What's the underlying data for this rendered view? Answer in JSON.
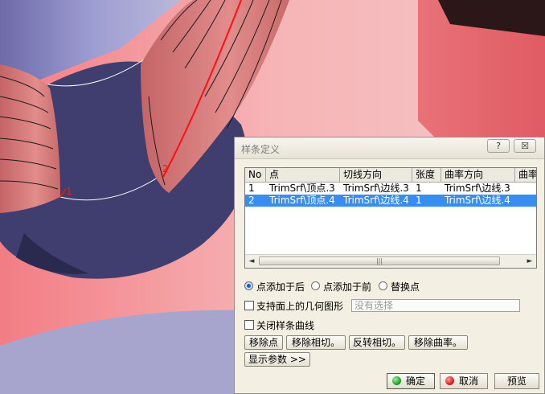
{
  "dialog": {
    "title": "样条定义",
    "help_glyph": "?",
    "close_glyph": "☒"
  },
  "grid": {
    "columns": [
      "No",
      "点",
      "切线方向",
      "张度",
      "曲率方向",
      "曲率"
    ],
    "rows": [
      {
        "no": "1",
        "point": "TrimSrf\\顶点.3",
        "tangent": "TrimSrf\\边线.3",
        "tension": "1",
        "curvature": "TrimSrf\\边线.3",
        "selected": false
      },
      {
        "no": "2",
        "point": "TrimSrf\\顶点.4",
        "tangent": "TrimSrf\\边线.4",
        "tension": "1",
        "curvature": "TrimSrf\\边线.4",
        "selected": true
      }
    ],
    "scroll_left": "◄",
    "scroll_right": "►",
    "scroll_grip": "|||"
  },
  "point_mode": {
    "options": [
      "点添加于后",
      "点添加于前",
      "替换点"
    ],
    "selected": "点添加于后"
  },
  "geometry_on_support": {
    "label": "支持面上的几何图形",
    "checked": false,
    "placeholder": "没有选择"
  },
  "close_spline": {
    "label": "关闭样条曲线",
    "checked": false
  },
  "actions": {
    "remove_point": "移除点",
    "remove_tangent": "移除相切。",
    "reverse_tangent": "反转相切。",
    "remove_curvature": "移除曲率。",
    "show_params": "显示参数 >>"
  },
  "footer": {
    "ok": "确定",
    "cancel": "取消",
    "preview": "预览"
  },
  "viewport_labels": {
    "point1": "1",
    "point2": "2"
  },
  "colors": {
    "selection": "#3a8df0",
    "ok_green": "#1ea52b",
    "cancel_red": "#d8231f",
    "spline_red": "#ff1010"
  }
}
